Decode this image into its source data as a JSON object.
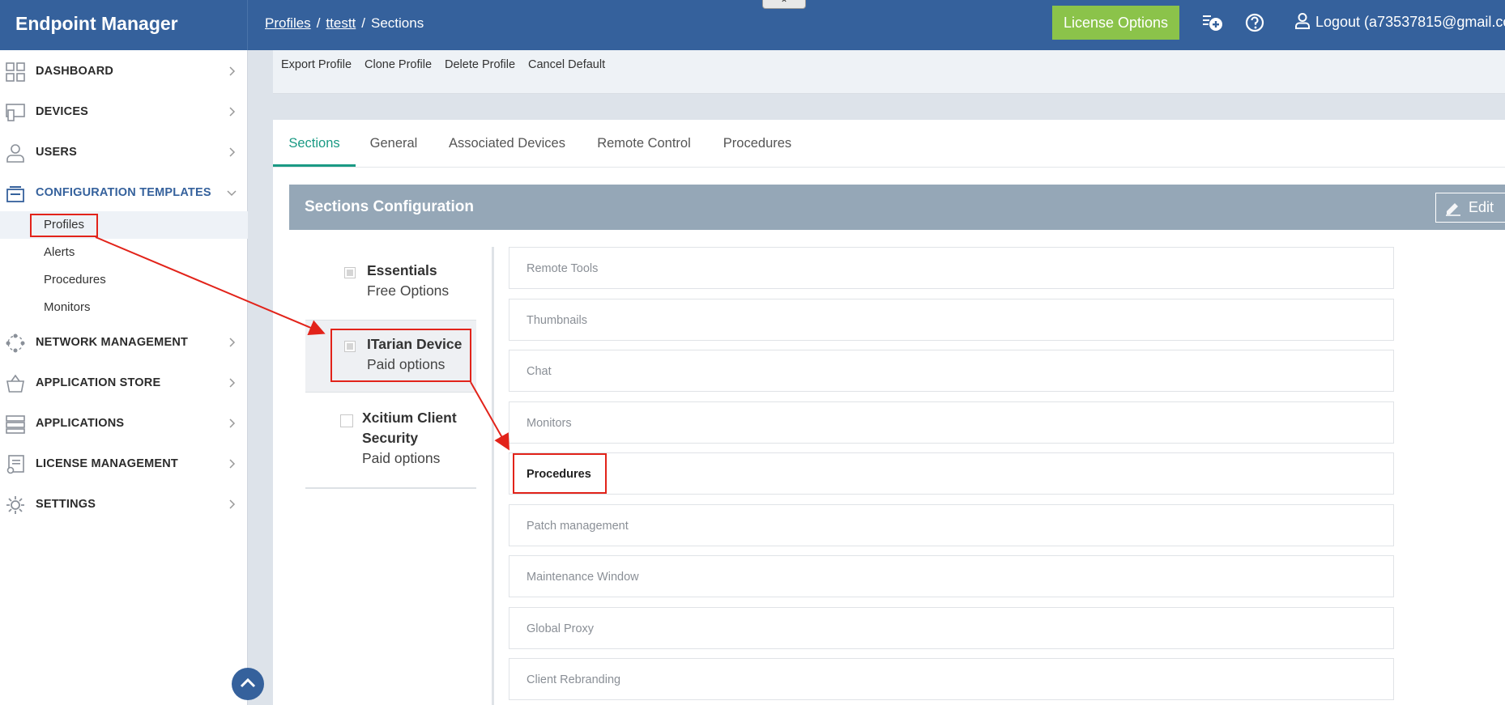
{
  "app": {
    "title": "Endpoint Manager"
  },
  "breadcrumb": {
    "items": [
      "Profiles",
      "ttestt",
      "Sections"
    ],
    "separator": "/"
  },
  "header": {
    "license_button": "License Options",
    "logout_label": "Logout (a73537815@gmail.co",
    "icons": [
      "add-notification-icon",
      "help-icon",
      "user-icon"
    ]
  },
  "sidebar": {
    "items": [
      {
        "label": "DASHBOARD",
        "icon": "dashboard-icon"
      },
      {
        "label": "DEVICES",
        "icon": "devices-icon"
      },
      {
        "label": "USERS",
        "icon": "user-icon"
      },
      {
        "label": "CONFIGURATION TEMPLATES",
        "icon": "templates-icon",
        "expanded": true
      },
      {
        "label": "NETWORK MANAGEMENT",
        "icon": "network-icon"
      },
      {
        "label": "APPLICATION STORE",
        "icon": "store-basket-icon"
      },
      {
        "label": "APPLICATIONS",
        "icon": "applications-icon"
      },
      {
        "label": "LICENSE MANAGEMENT",
        "icon": "license-icon"
      },
      {
        "label": "SETTINGS",
        "icon": "gear-icon"
      }
    ],
    "sub_items": [
      "Profiles",
      "Alerts",
      "Procedures",
      "Monitors"
    ],
    "selected_sub_item": "Profiles"
  },
  "toolbar": {
    "buttons": [
      "Export Profile",
      "Clone Profile",
      "Delete Profile",
      "Cancel Default"
    ]
  },
  "tabs": {
    "items": [
      "Sections",
      "General",
      "Associated Devices",
      "Remote Control",
      "Procedures"
    ],
    "active": "Sections"
  },
  "sections_config": {
    "title": "Sections Configuration",
    "edit_label": "Edit",
    "categories": [
      {
        "title": "Essentials",
        "subtitle": "Free Options"
      },
      {
        "title": "ITarian Device",
        "subtitle": "Paid options"
      },
      {
        "title_line1": "Xcitium Client",
        "title_line2": "Security",
        "subtitle": "Paid options"
      }
    ],
    "sections": [
      "Remote Tools",
      "Thumbnails",
      "Chat",
      "Monitors",
      "Procedures",
      "Patch management",
      "Maintenance Window",
      "Global Proxy",
      "Client Rebranding"
    ],
    "highlighted_section": "Procedures"
  },
  "colors": {
    "header_bg": "#35619c",
    "license_button": "#8bc34a",
    "active_tab": "#1a9a84",
    "section_header": "#95a7b7",
    "annotation": "#e2231a"
  }
}
